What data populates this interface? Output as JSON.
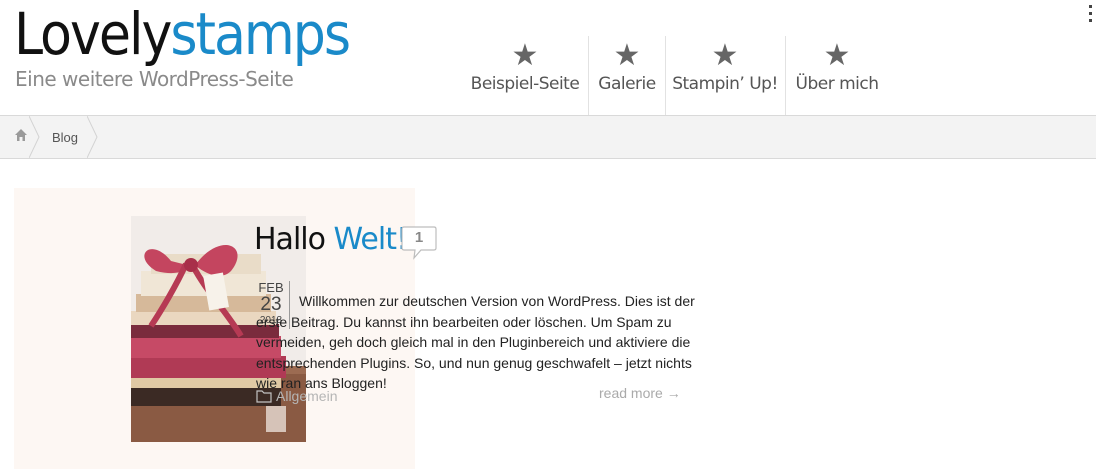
{
  "site": {
    "title_part1": "Lovely",
    "title_part2": "stamps",
    "tagline": "Eine weitere WordPress-Seite"
  },
  "nav": {
    "items": [
      {
        "label": "Beispiel-Seite",
        "icon": "star-icon"
      },
      {
        "label": "Galerie",
        "icon": "star-icon"
      },
      {
        "label": "Stampin’ Up!",
        "icon": "star-icon"
      },
      {
        "label": "Über mich",
        "icon": "star-icon"
      }
    ]
  },
  "breadcrumb": {
    "home_icon": "home-icon",
    "items": [
      "Blog"
    ]
  },
  "post": {
    "title_part1": "Hallo",
    "title_part2": "Welt!",
    "comment_count": "1",
    "date": {
      "month": "FEB",
      "day": "23",
      "year": "2013"
    },
    "excerpt": "Willkommen zur deutschen Version von WordPress. Dies ist der erste Beitrag. Du kannst ihn bearbeiten oder löschen. Um Spam zu vermeiden, geh doch gleich mal in den Pluginbereich und aktiviere die entsprechenden Plugins. So, und nun genug geschwafelt – jetzt nichts wie ran ans Bloggen!",
    "read_more": "read more →",
    "category": "Allgemein",
    "category_icon": "folder-icon"
  },
  "colors": {
    "accent": "#1a8ac9",
    "card_bg": "#fdf7f3",
    "crumb_bg": "#f3f3f3"
  }
}
